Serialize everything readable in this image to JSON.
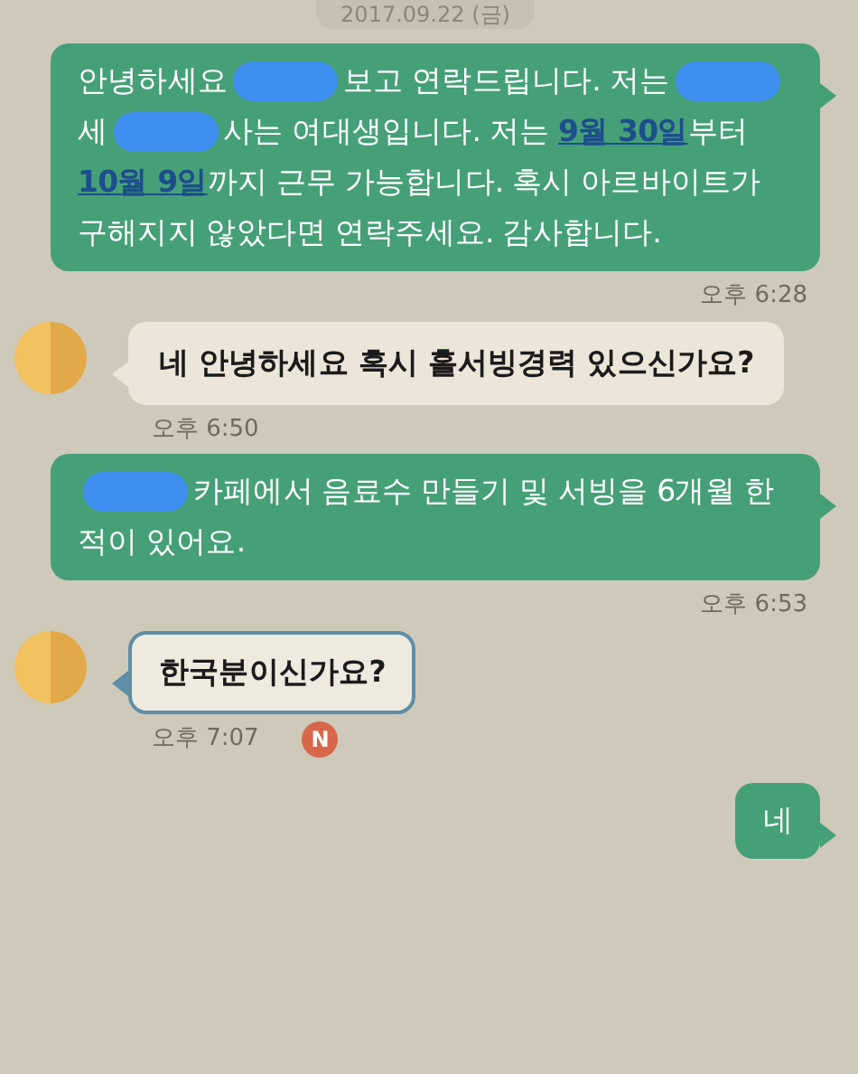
{
  "date_header": "2017.09.22 (금)",
  "messages": [
    {
      "kind": "outgoing",
      "parts": [
        {
          "kind": "text",
          "text": "안녕하세요"
        },
        {
          "kind": "redacted"
        },
        {
          "kind": "text",
          "text": "보고 연락드립니다. 저는"
        },
        {
          "kind": "redacted"
        },
        {
          "kind": "text",
          "text": "세"
        },
        {
          "kind": "redacted"
        },
        {
          "kind": "text",
          "text": "사는 여대생입니다. 저는 "
        },
        {
          "kind": "link",
          "text": "9월 30일"
        },
        {
          "kind": "text",
          "text": "부터 "
        },
        {
          "kind": "link",
          "text": "10월 9일"
        },
        {
          "kind": "text",
          "text": "까지 근무 가능합니다. 혹시 아르바이트가 구해지지 않았다면 연락주세요. 감사합니다."
        }
      ],
      "time": "오후 6:28"
    },
    {
      "kind": "incoming",
      "highlighted": false,
      "parts": [
        {
          "kind": "text",
          "text": "네 안녕하세요 혹시 홀서빙경력 있으신가요?"
        }
      ],
      "time": "오후 6:50"
    },
    {
      "kind": "outgoing",
      "parts": [
        {
          "kind": "redacted"
        },
        {
          "kind": "text",
          "text": "카페에서 음료수 만들기 및 서빙을 6개월 한 적이 있어요."
        }
      ],
      "time": "오후 6:53"
    },
    {
      "kind": "incoming",
      "highlighted": true,
      "parts": [
        {
          "kind": "text",
          "text": "한국분이신가요?"
        }
      ],
      "time": "오후 7:07",
      "badge": "N"
    },
    {
      "kind": "outgoing",
      "parts": [
        {
          "kind": "text",
          "text": "네"
        }
      ]
    }
  ]
}
